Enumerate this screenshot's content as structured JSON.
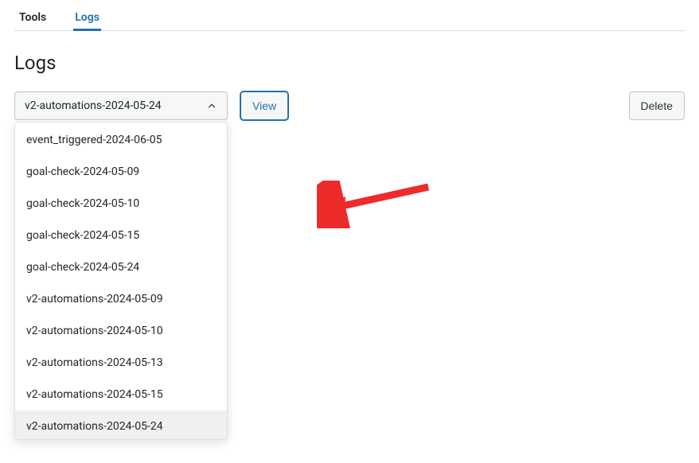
{
  "tabs": {
    "tools": "Tools",
    "logs": "Logs",
    "active": "logs"
  },
  "page_title": "Logs",
  "select": {
    "selected": "v2-automations-2024-05-24",
    "options": [
      "event_triggered-2024-06-05",
      "goal-check-2024-05-09",
      "goal-check-2024-05-10",
      "goal-check-2024-05-15",
      "goal-check-2024-05-24",
      "v2-automations-2024-05-09",
      "v2-automations-2024-05-10",
      "v2-automations-2024-05-13",
      "v2-automations-2024-05-15",
      "v2-automations-2024-05-24"
    ]
  },
  "buttons": {
    "view": "View",
    "delete": "Delete"
  },
  "colors": {
    "accent": "#2271b1",
    "arrow": "#ee2b2b"
  }
}
